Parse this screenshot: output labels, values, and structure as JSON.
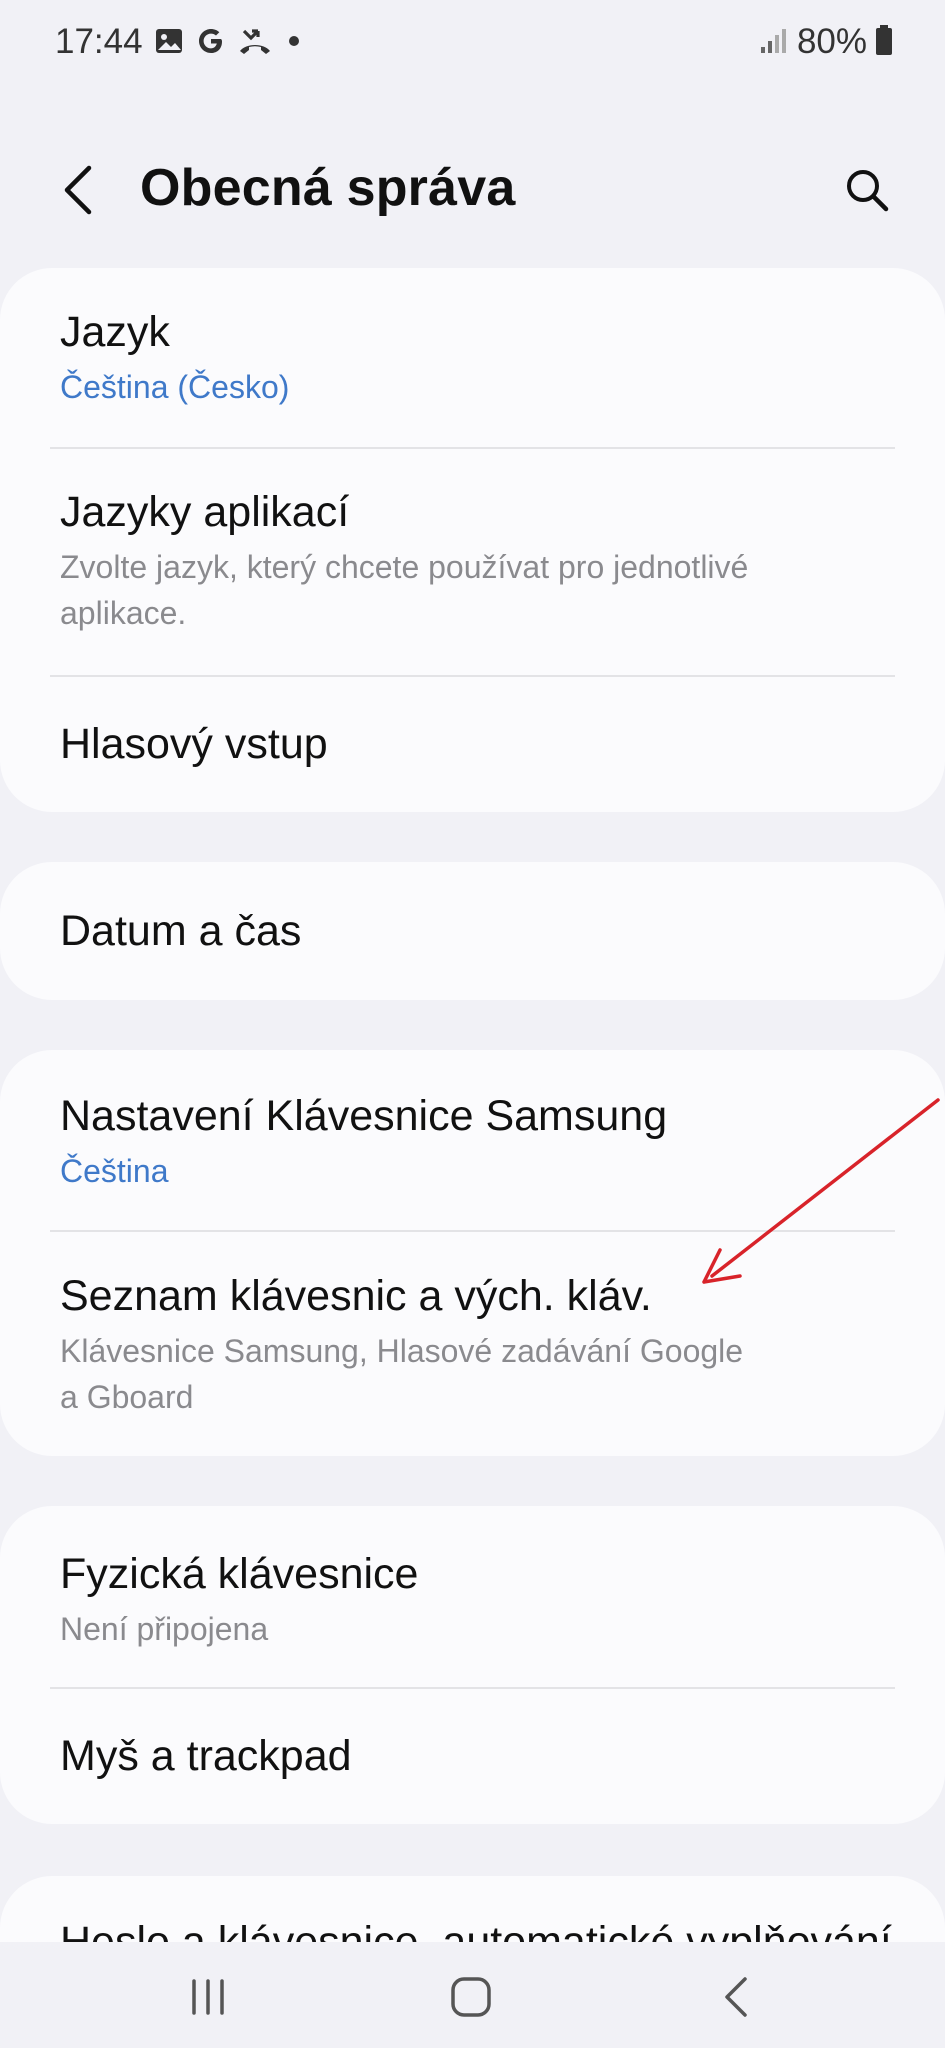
{
  "status_bar": {
    "time": "17:44",
    "battery": "80%",
    "icons": [
      "gallery-icon",
      "google-icon",
      "missed-call-icon",
      "dot-icon",
      "signal-icon",
      "battery-icon"
    ]
  },
  "header": {
    "title": "Obecná správa",
    "back_icon": "back-arrow-icon",
    "search_icon": "search-icon"
  },
  "groups": [
    {
      "items": [
        {
          "title": "Jazyk",
          "subtitle": "Čeština (Česko)",
          "subtitle_style": "accent"
        },
        {
          "title": "Jazyky aplikací",
          "subtitle_line1": "Zvolte jazyk, který chcete používat pro jednotlivé",
          "subtitle_line2": "aplikace."
        },
        {
          "title": "Hlasový vstup"
        }
      ]
    },
    {
      "items": [
        {
          "title": "Datum a čas"
        }
      ]
    },
    {
      "items": [
        {
          "title": "Nastavení Klávesnice Samsung",
          "subtitle": "Čeština",
          "subtitle_style": "accent"
        },
        {
          "title": "Seznam klávesnic a vých. kláv.",
          "subtitle_line1": "Klávesnice Samsung, Hlasové zadávání Google",
          "subtitle_line2": "a Gboard"
        }
      ]
    },
    {
      "items": [
        {
          "title": "Fyzická klávesnice",
          "subtitle": "Není připojena"
        },
        {
          "title": "Myš a trackpad"
        }
      ]
    }
  ],
  "partial_item": {
    "title": "Heslo a klávesnice, automatické vyplňování"
  },
  "nav_bar": {
    "icons": [
      "recent-apps-icon",
      "home-icon",
      "back-icon"
    ]
  },
  "colors": {
    "background": "#f1f1f6",
    "card": "#fbfbfd",
    "accent": "#3f79c9",
    "secondary_text": "#8a8a8e",
    "annotation": "#d8232a"
  }
}
